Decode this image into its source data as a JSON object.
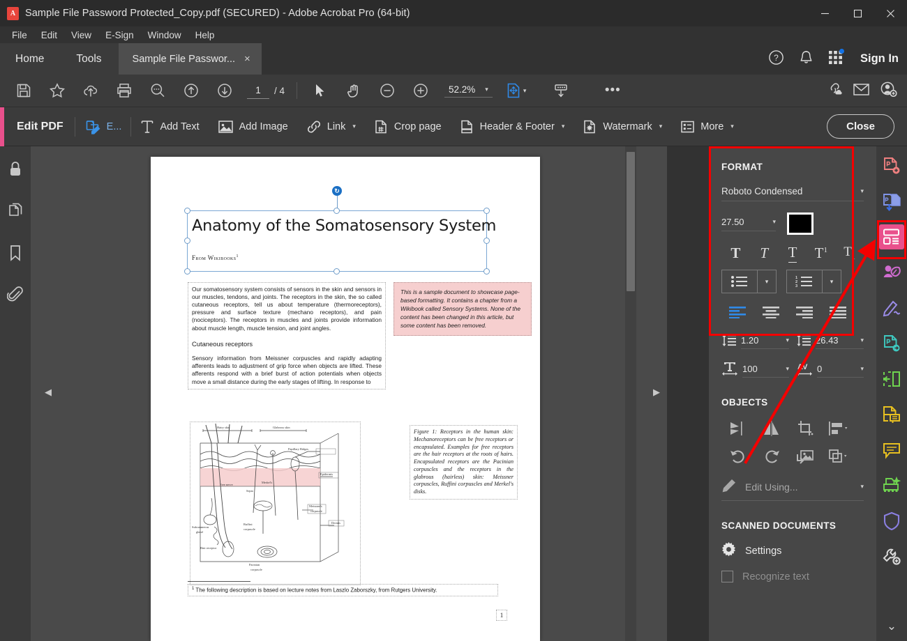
{
  "window": {
    "title": "Sample File Password Protected_Copy.pdf (SECURED) - Adobe Acrobat Pro (64-bit)",
    "app_icon": "pdf-file-icon",
    "minimize": "minimize-button",
    "maximize": "maximize-button",
    "close": "close-window-button"
  },
  "menubar": {
    "items": [
      "File",
      "Edit",
      "View",
      "E-Sign",
      "Window",
      "Help"
    ]
  },
  "tabbar": {
    "home": "Home",
    "tools": "Tools",
    "document_tab": "Sample File Passwor...",
    "close_glyph": "×",
    "sign_in": "Sign In"
  },
  "toolbar": {
    "icons": [
      "save-icon",
      "star-icon",
      "upload-cloud-icon",
      "print-icon",
      "search-icon",
      "previous-page-icon",
      "next-page-icon"
    ],
    "page_current": "1",
    "page_total": "/ 4",
    "zoom_level": "52.2%",
    "more_glyph": "•••",
    "right_icons": [
      "share-link-icon",
      "email-icon",
      "add-person-icon"
    ]
  },
  "editbar": {
    "title": "Edit PDF",
    "edit_truncated": "E...",
    "add_text": "Add Text",
    "add_image": "Add Image",
    "link": "Link",
    "crop_page": "Crop page",
    "header_footer": "Header & Footer",
    "watermark": "Watermark",
    "more": "More",
    "close": "Close",
    "caret": "▾",
    "accent_color": "#e9508c"
  },
  "leftrail": {
    "items": [
      "security-lock-icon",
      "page-thumbnails-icon",
      "bookmark-icon",
      "attachment-icon"
    ]
  },
  "document": {
    "title": "Anatomy of the Somatosensory System",
    "subtitle": "From Wikibooks",
    "subtitle_sup": "1",
    "paragraph_1": "Our somatosensory system consists of sensors in the skin and sensors in our muscles, tendons, and joints. The receptors in the skin, the so called cutaneous receptors, tell us about temperature (thermoreceptors), pressure and surface texture (mechano receptors), and pain (nociceptors). The receptors in muscles and joints provide information about muscle length, muscle tension, and joint angles.",
    "section_heading": "Cutaneous receptors",
    "paragraph_2": "Sensory information from Meissner corpuscles and rapidly adapting afferents leads to adjustment of grip force when objects are lifted. These afferents respond with a brief burst of action potentials when objects move a small distance during the early stages of lifting. In response to",
    "callout": "This is a sample document to showcase page-based formatting. It contains a chapter from a Wikibook called Sensory Systems. None of the content has been changed in this article, but some content has been removed.",
    "figure_caption": "Figure 1: Receptors in the human skin: Mechanoreceptors can be free receptors or encapsulated. Examples for free receptors are the hair receptors at the roots of hairs. Encapsulated receptors are the Pacinian corpuscles and the receptors in the glabrous (hairless) skin: Meissner corpuscles, Ruffini corpuscles and Merkel's disks.",
    "footnote_sup": "1",
    "footnote": "The following description is based on lecture notes from Laszlo Zaborszky, from Rutgers University.",
    "page_label": "1",
    "figure_labels": [
      "Hairy skin",
      "Glabrous skin",
      "Papillary Ridges",
      "Epidermis",
      "Free nerve",
      "Merkel's",
      "Septa",
      "Meissner's corpuscle",
      "Dermis",
      "Subcutaneous gland",
      "Ruffini corpuscle",
      "Hair receptor",
      "Pacinian corpuscle"
    ]
  },
  "format_panel": {
    "heading": "FORMAT",
    "font_name": "Roboto Condensed",
    "font_size": "27.50",
    "color_hex": "#000000",
    "style_buttons": [
      "bold-text-icon",
      "italic-text-icon",
      "underline-text-icon",
      "superscript-text-icon",
      "subscript-text-icon"
    ],
    "bullet_list": "bullet-list-icon",
    "numbered_list": "numbered-list-icon",
    "align_buttons": [
      "align-left-icon",
      "align-center-icon",
      "align-right-icon",
      "align-justify-icon"
    ],
    "active_align": "align-left-icon",
    "line_spacing": "1.20",
    "paragraph_spacing": "26.43",
    "horizontal_scale": "100",
    "character_spacing": "0",
    "caret": "▾"
  },
  "objects_panel": {
    "heading": "OBJECTS",
    "buttons": [
      "flip-vertical-icon",
      "flip-horizontal-icon",
      "crop-icon",
      "align-objects-icon",
      "rotate-counterclockwise-icon",
      "rotate-clockwise-icon",
      "replace-image-icon",
      "arrange-icon"
    ],
    "edit_using": "Edit Using..."
  },
  "scanned_panel": {
    "heading": "SCANNED DOCUMENTS",
    "settings": "Settings",
    "recognize_text": "Recognize text"
  },
  "toolrail": {
    "items": [
      {
        "name": "create-pdf-icon",
        "color": "#f08080"
      },
      {
        "name": "combine-files-icon",
        "color": "#8094e8"
      },
      {
        "name": "edit-pdf-icon",
        "color": "#ffffff"
      },
      {
        "name": "redact-icon",
        "color": "#d06cd0"
      },
      {
        "name": "fill-sign-icon",
        "color": "#9b8ce8"
      },
      {
        "name": "export-pdf-icon",
        "color": "#3ec9c0"
      },
      {
        "name": "organize-pages-icon",
        "color": "#6fd44f"
      },
      {
        "name": "comment-page-icon",
        "color": "#e8c020"
      },
      {
        "name": "comment-icon",
        "color": "#e8c020"
      },
      {
        "name": "scan-ocr-icon",
        "color": "#6fd44f"
      },
      {
        "name": "protect-icon",
        "color": "#8a7fe0"
      },
      {
        "name": "more-tools-icon",
        "color": "#d8d8d8"
      }
    ],
    "active_index": 2,
    "chevron": "⌄"
  },
  "annotations": {
    "highlight_color": "#f40000"
  }
}
